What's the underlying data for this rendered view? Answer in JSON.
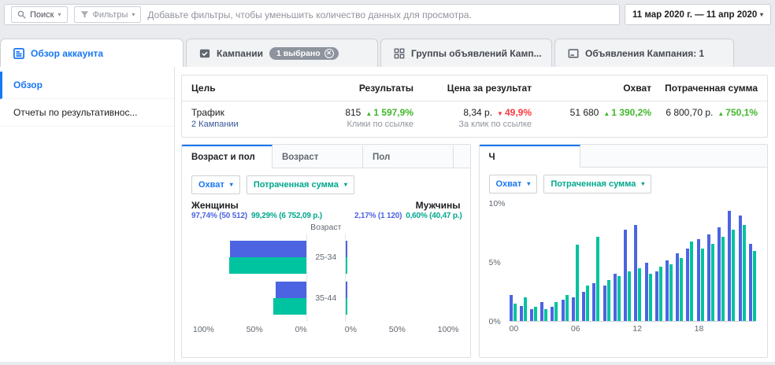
{
  "colors": {
    "brand_blue": "#1877f2",
    "chart_blue": "#4c64e1",
    "chart_teal": "#00c3a0",
    "positive_green": "#42b72a",
    "negative_red": "#fa383e"
  },
  "toolbar": {
    "search_label": "Поиск",
    "filters_label": "Фильтры",
    "placeholder": "Добавьте фильтры, чтобы уменьшить количество данных для просмотра.",
    "date_range": "11 мар 2020 г. — 11 апр 2020"
  },
  "tabs": {
    "account_overview": "Обзор аккаунта",
    "campaigns": "Кампании",
    "campaigns_badge": "1 выбрано",
    "ad_sets": "Группы объявлений Камп...",
    "ads": "Объявления Кампания: 1"
  },
  "sidebar": {
    "overview": "Обзор",
    "reports": "Отчеты по результативнос..."
  },
  "summary": {
    "headers": [
      "Цель",
      "Результаты",
      "Цена за результат",
      "Охват",
      "Потраченная сумма"
    ],
    "objective": "Трафик",
    "objective_link": "2 Кампании",
    "results_value": "815",
    "results_delta": "1 597,9%",
    "results_sub": "Клики по ссылке",
    "cost_value": "8,34 р.",
    "cost_delta": "49,9%",
    "cost_sub": "За клик по ссылке",
    "reach_value": "51 680",
    "reach_delta": "1 390,2%",
    "spend_value": "6 800,70 р.",
    "spend_delta": "750,1%"
  },
  "demographics": {
    "tab_age_gender": "Возраст и пол",
    "tab_age": "Возраст",
    "tab_gender": "Пол",
    "reach_dropdown": "Охват",
    "spend_dropdown": "Потраченная сумма",
    "women_label": "Женщины",
    "women_reach": "97,74% (50 512)",
    "women_spend": "99,29% (6 752,09 р.)",
    "men_label": "Мужчины",
    "men_reach": "2,17% (1 120)",
    "men_spend": "0,60% (40,47 р.)",
    "axis_title": "Возраст"
  },
  "hours": {
    "tab": "Ч",
    "reach_dropdown": "Охват",
    "spend_dropdown": "Потраченная сумма"
  },
  "chart_data": [
    {
      "id": "age_gender",
      "type": "bar",
      "orientation": "horizontal",
      "title": "Возраст и пол",
      "categories": [
        "25-34",
        "35-44"
      ],
      "xlim": [
        0,
        100
      ],
      "x_ticks_left": [
        "100%",
        "50%",
        "0%"
      ],
      "x_ticks_right": [
        "0%",
        "50%",
        "100%"
      ],
      "series": [
        {
          "name": "Охват — Женщины",
          "color": "#4c64e1",
          "values": [
            67,
            27
          ]
        },
        {
          "name": "Потраченная сумма — Женщины",
          "color": "#00c3a0",
          "values": [
            68,
            29
          ]
        },
        {
          "name": "Охват — Мужчины",
          "color": "#4c64e1",
          "values": [
            1.6,
            0.6
          ]
        },
        {
          "name": "Потраченная сумма — Мужчины",
          "color": "#00c3a0",
          "values": [
            0.5,
            0.2
          ]
        }
      ]
    },
    {
      "id": "hours",
      "type": "bar",
      "title": "Ч",
      "x": [
        "00",
        "01",
        "02",
        "03",
        "04",
        "05",
        "06",
        "07",
        "08",
        "09",
        "10",
        "11",
        "12",
        "13",
        "14",
        "15",
        "16",
        "17",
        "18",
        "19",
        "20",
        "21",
        "22",
        "23"
      ],
      "x_ticks": [
        "00",
        "06",
        "12",
        "18"
      ],
      "y_ticks": [
        "0%",
        "5%",
        "10%"
      ],
      "ylim": [
        0,
        10
      ],
      "series": [
        {
          "name": "Охват",
          "color": "#4c64e1",
          "values": [
            2.2,
            1.3,
            1.0,
            1.6,
            1.2,
            1.8,
            2.0,
            2.5,
            3.2,
            3.0,
            4.0,
            7.8,
            8.2,
            5.0,
            4.2,
            5.2,
            5.8,
            6.2,
            7.0,
            7.4,
            8.0,
            9.4,
            9.0,
            6.6
          ]
        },
        {
          "name": "Потраченная сумма",
          "color": "#00c3a0",
          "values": [
            1.5,
            2.0,
            1.2,
            1.0,
            1.6,
            2.2,
            6.5,
            3.0,
            7.2,
            3.5,
            3.8,
            4.2,
            4.5,
            4.0,
            4.6,
            4.8,
            5.4,
            6.8,
            6.2,
            6.6,
            7.2,
            7.8,
            8.2,
            6.0
          ]
        }
      ]
    }
  ]
}
